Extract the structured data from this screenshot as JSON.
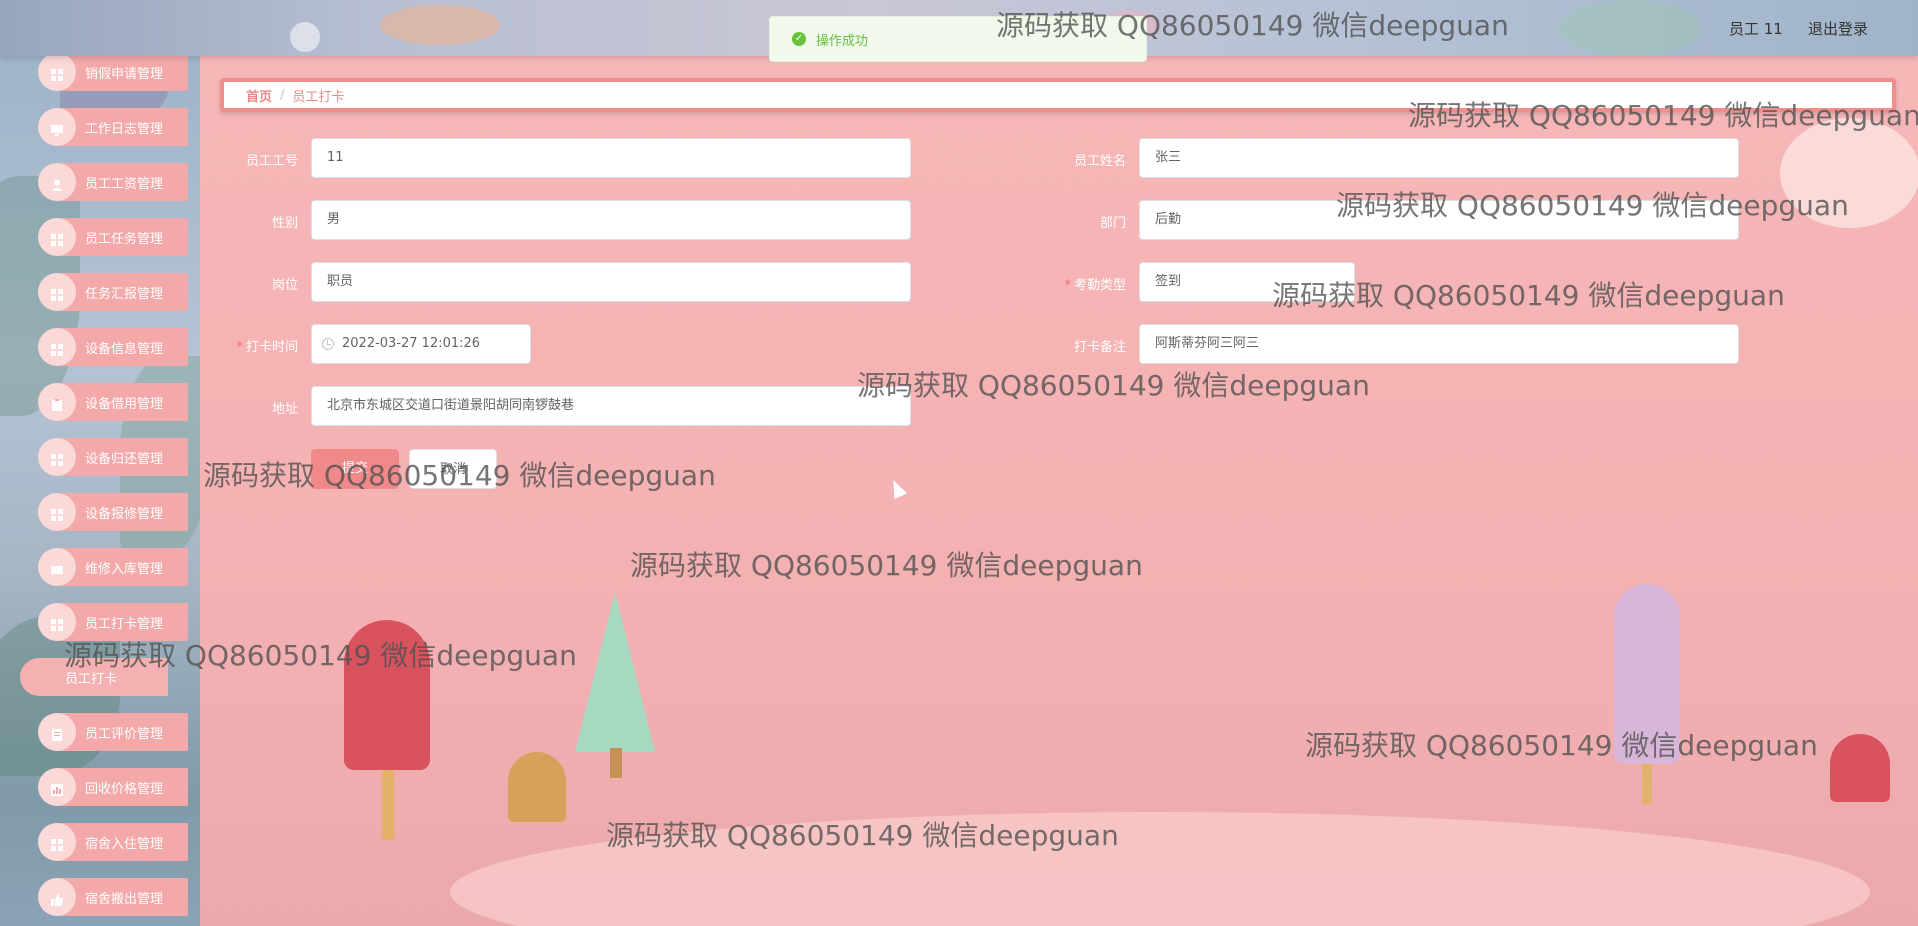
{
  "toast": {
    "message": "操作成功"
  },
  "header": {
    "user": "员工 11",
    "logout": "退出登录"
  },
  "sidebar": {
    "items": [
      {
        "label": "销假申请管理",
        "icon": "grid-icon"
      },
      {
        "label": "工作日志管理",
        "icon": "monitor-icon"
      },
      {
        "label": "员工工资管理",
        "icon": "person-icon"
      },
      {
        "label": "员工任务管理",
        "icon": "grid-icon"
      },
      {
        "label": "任务汇报管理",
        "icon": "grid-icon"
      },
      {
        "label": "设备信息管理",
        "icon": "grid-icon"
      },
      {
        "label": "设备借用管理",
        "icon": "clipboard-icon"
      },
      {
        "label": "设备归还管理",
        "icon": "grid-icon"
      },
      {
        "label": "设备报修管理",
        "icon": "grid-icon"
      },
      {
        "label": "维修入库管理",
        "icon": "ticket-icon"
      },
      {
        "label": "员工打卡管理",
        "icon": "grid-icon"
      },
      {
        "label": "员工打卡",
        "icon": ""
      },
      {
        "label": "员工评价管理",
        "icon": "doc-icon"
      },
      {
        "label": "回收价格管理",
        "icon": "chart-icon"
      },
      {
        "label": "宿舍入住管理",
        "icon": "grid-icon"
      },
      {
        "label": "宿舍搬出管理",
        "icon": "thumb-icon"
      }
    ]
  },
  "breadcrumb": {
    "home": "首页",
    "sep": "/",
    "current": "员工打卡"
  },
  "form": {
    "employee_no_label": "员工工号",
    "employee_no": "11",
    "employee_name_label": "员工姓名",
    "employee_name": "张三",
    "gender_label": "性别",
    "gender": "男",
    "department_label": "部门",
    "department": "后勤",
    "position_label": "岗位",
    "position": "职员",
    "attendance_type_label": "考勤类型",
    "attendance_type": "签到",
    "punch_time_label": "打卡时间",
    "punch_time": "2022-03-27 12:01:26",
    "punch_note_label": "打卡备注",
    "punch_note": "阿斯蒂芬阿三阿三",
    "address_label": "地址",
    "address": "北京市东城区交道口街道景阳胡同南锣鼓巷",
    "required_mark": "*",
    "submit": "提交",
    "cancel": "取消"
  },
  "watermark": "源码获取 QQ86050149 微信deepguan"
}
